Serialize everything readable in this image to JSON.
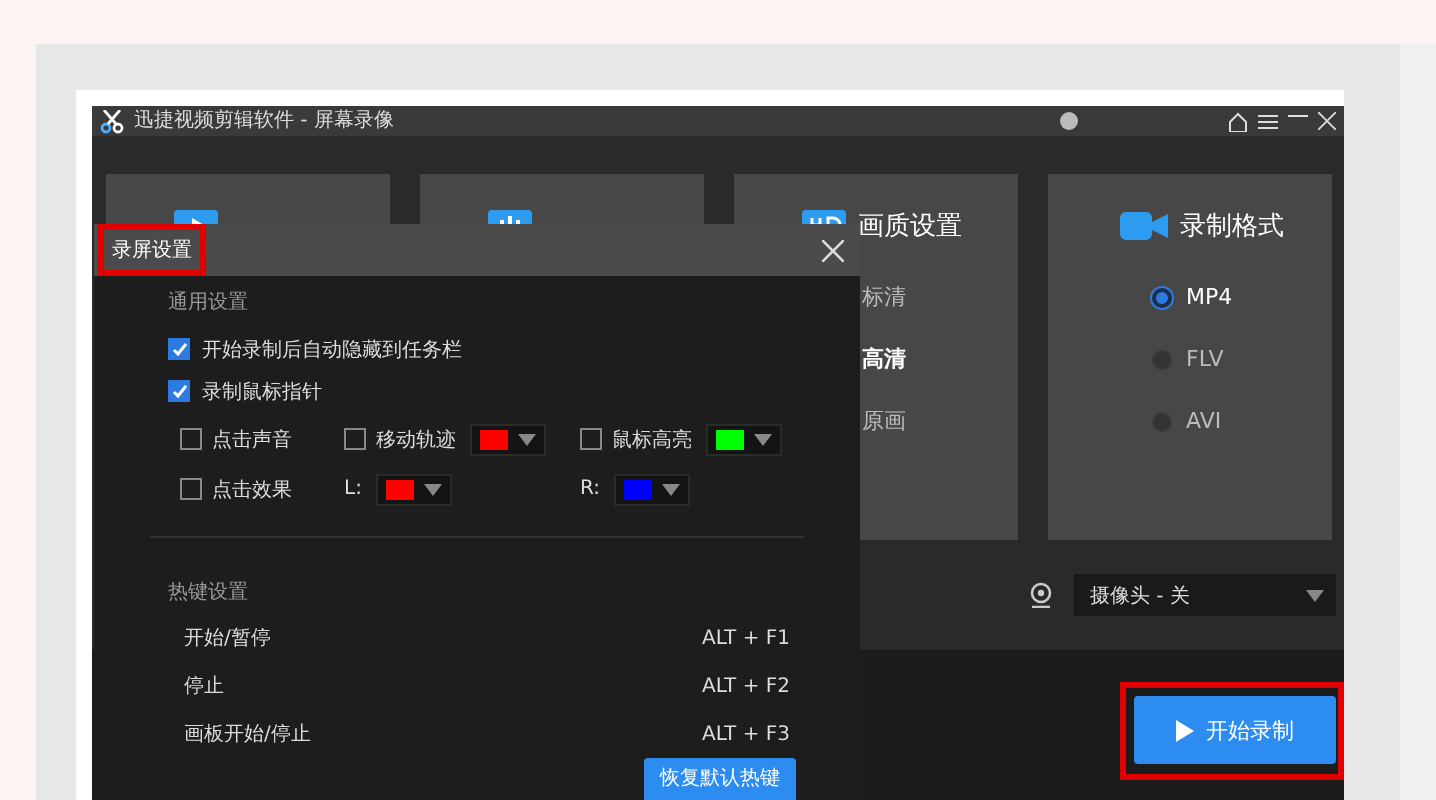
{
  "window": {
    "title": "迅捷视频剪辑软件 - 屏幕录像"
  },
  "cards": [
    {
      "kind": "video"
    },
    {
      "kind": "audio"
    },
    {
      "kind": "quality",
      "title": "画质设置",
      "options": [
        {
          "label": "标清",
          "selected": false
        },
        {
          "label": "高清",
          "selected": true
        },
        {
          "label": "原画",
          "selected": false
        }
      ]
    },
    {
      "kind": "format",
      "title": "录制格式",
      "options": [
        {
          "label": "MP4",
          "selected": true
        },
        {
          "label": "FLV",
          "selected": false
        },
        {
          "label": "AVI",
          "selected": false
        }
      ]
    }
  ],
  "camera": {
    "value": "摄像头 - 关"
  },
  "start_button": {
    "label": "开始录制",
    "highlighted": true
  },
  "dialog": {
    "title": "录屏设置",
    "title_highlighted": true,
    "general": {
      "heading": "通用设置",
      "options": [
        {
          "label": "开始录制后自动隐藏到任务栏",
          "checked": true
        },
        {
          "label": "录制鼠标指针",
          "checked": true
        }
      ]
    },
    "mouse_options": [
      {
        "kind": "checkbox",
        "label": "点击声音",
        "checked": false
      },
      {
        "kind": "checkbox",
        "label": "移动轨迹",
        "checked": false,
        "color": "#ff0000"
      },
      {
        "kind": "checkbox",
        "label": "鼠标高亮",
        "checked": false,
        "color": "#00ff00"
      },
      {
        "kind": "checkbox",
        "label": "点击效果",
        "checked": false
      },
      {
        "kind": "color",
        "label": "L:",
        "color": "#ff0000"
      },
      {
        "kind": "color",
        "label": "R:",
        "color": "#0000ff"
      }
    ],
    "hotkeys": {
      "heading": "热键设置",
      "rows": [
        {
          "action": "开始/暂停",
          "key": "ALT + F1"
        },
        {
          "action": "停止",
          "key": "ALT + F2"
        },
        {
          "action": "画板开始/停止",
          "key": "ALT + F3"
        }
      ],
      "reset_button": "恢复默认热键"
    }
  }
}
